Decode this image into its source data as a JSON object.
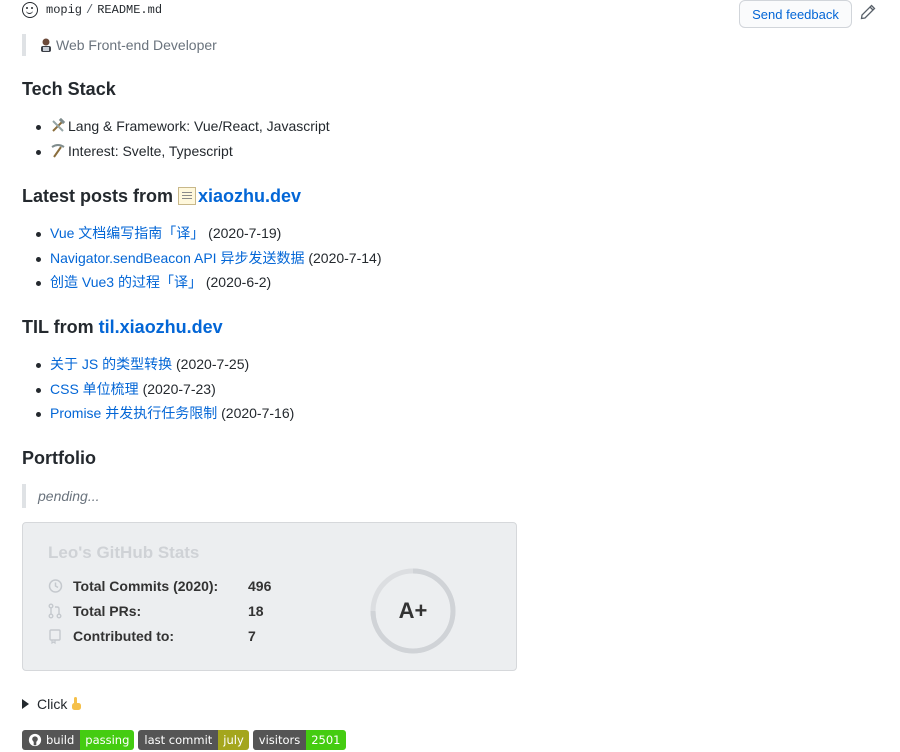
{
  "file_path": {
    "owner": "mopig",
    "separator": "/",
    "file": "README.md"
  },
  "toolbar": {
    "feedback_label": "Send feedback"
  },
  "intro_quote": "Web Front-end Developer",
  "tech_stack": {
    "heading": "Tech Stack",
    "items": [
      "Lang & Framework: Vue/React, Javascript",
      "Interest: Svelte, Typescript"
    ]
  },
  "latest_posts": {
    "heading_prefix": "Latest posts from ",
    "link": "xiaozhu.dev",
    "items": [
      {
        "title": "Vue 文档编写指南「译」",
        "date": " (2020-7-19)"
      },
      {
        "title": "Navigator.sendBeacon API 异步发送数据",
        "date": " (2020-7-14)"
      },
      {
        "title": "创造 Vue3 的过程「译」",
        "date": " (2020-6-2)"
      }
    ]
  },
  "til": {
    "heading_prefix": "TIL from ",
    "link": "til.xiaozhu.dev",
    "items": [
      {
        "title": "关于 JS 的类型转换",
        "date": " (2020-7-25)"
      },
      {
        "title": "CSS 单位梳理",
        "date": " (2020-7-23)"
      },
      {
        "title": "Promise 并发执行任务限制",
        "date": " (2020-7-16)"
      }
    ]
  },
  "portfolio": {
    "heading": "Portfolio",
    "quote": "pending..."
  },
  "stats": {
    "title": "Leo's GitHub Stats",
    "rows": [
      {
        "label": "Total Commits (2020):",
        "value": "496",
        "icon": "history-icon"
      },
      {
        "label": "Total PRs:",
        "value": "18",
        "icon": "pull-request-icon"
      },
      {
        "label": "Contributed to:",
        "value": "7",
        "icon": "repo-icon"
      }
    ],
    "grade": "A+"
  },
  "details": {
    "summary": "Click"
  },
  "badges": [
    {
      "left": "build",
      "right": "passing",
      "color": "#4c1"
    },
    {
      "left": "last commit",
      "right": "july",
      "color": "#a4a61d"
    },
    {
      "left": "visitors",
      "right": "2501",
      "color": "#4c1"
    }
  ]
}
